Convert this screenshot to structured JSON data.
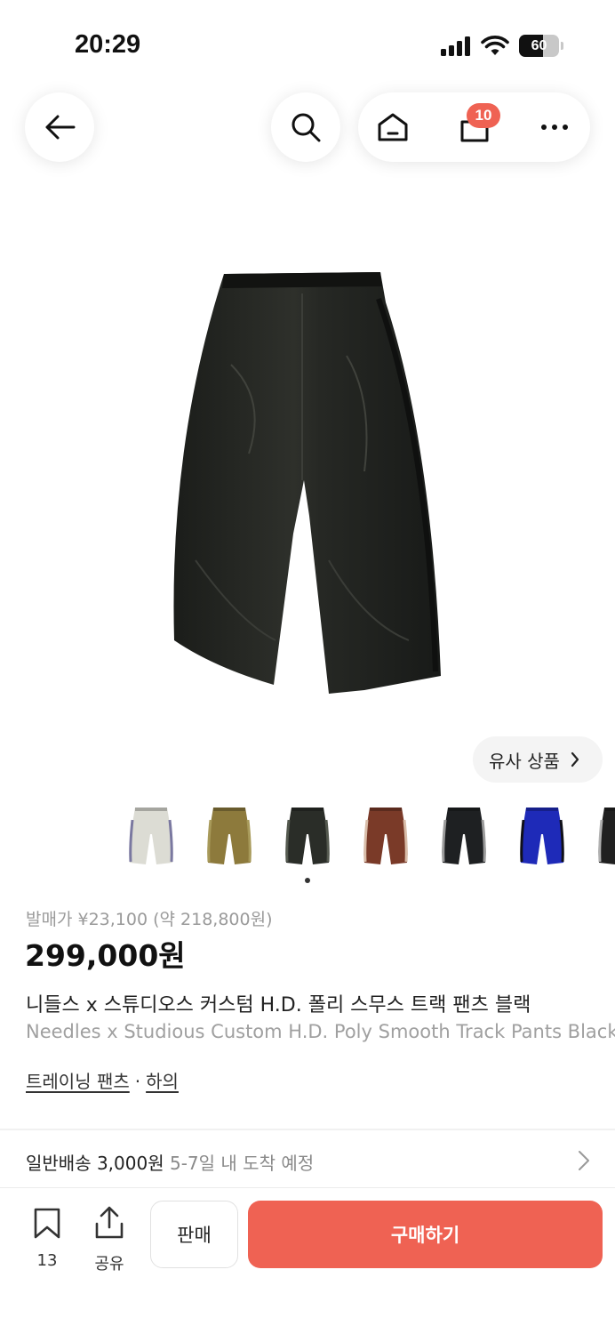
{
  "status": {
    "time": "20:29",
    "battery": "60",
    "battery_level": 0.6
  },
  "header": {
    "cart_count": "10"
  },
  "similar": {
    "label": "유사 상품"
  },
  "thumbnails": [
    {
      "color": "#dcdcd4",
      "stripe": "#7a78a0"
    },
    {
      "color": "#8d7a3c",
      "stripe": "#a89a5a"
    },
    {
      "color": "#2a2d28",
      "stripe": "#555a50"
    },
    {
      "color": "#7a3a28",
      "stripe": "#d8bca8"
    },
    {
      "color": "#1e2022",
      "stripe": "#9a9a9a"
    },
    {
      "color": "#1e2ab8",
      "stripe": "#101018"
    },
    {
      "color": "#202020",
      "stripe": "#b0b0b0"
    }
  ],
  "product": {
    "release_price": "발매가 ¥23,100 (약 218,800원)",
    "price": "299,000원",
    "title_ko": "니들스 x 스튜디오스 커스텀 H.D. 폴리 스무스 트랙 팬츠 블랙",
    "title_en": "Needles x Studious Custom H.D. Poly Smooth Track Pants Black",
    "category": "트레이닝 팬츠",
    "category_sep": "·",
    "category_parent": "하의"
  },
  "shipping": {
    "label": "일반배송 3,000원",
    "eta": "5-7일 내 도착 예정"
  },
  "bottom": {
    "wish_count": "13",
    "share_label": "공유",
    "sell_label": "판매",
    "buy_label": "구매하기"
  },
  "colors": {
    "accent": "#ef6253"
  }
}
